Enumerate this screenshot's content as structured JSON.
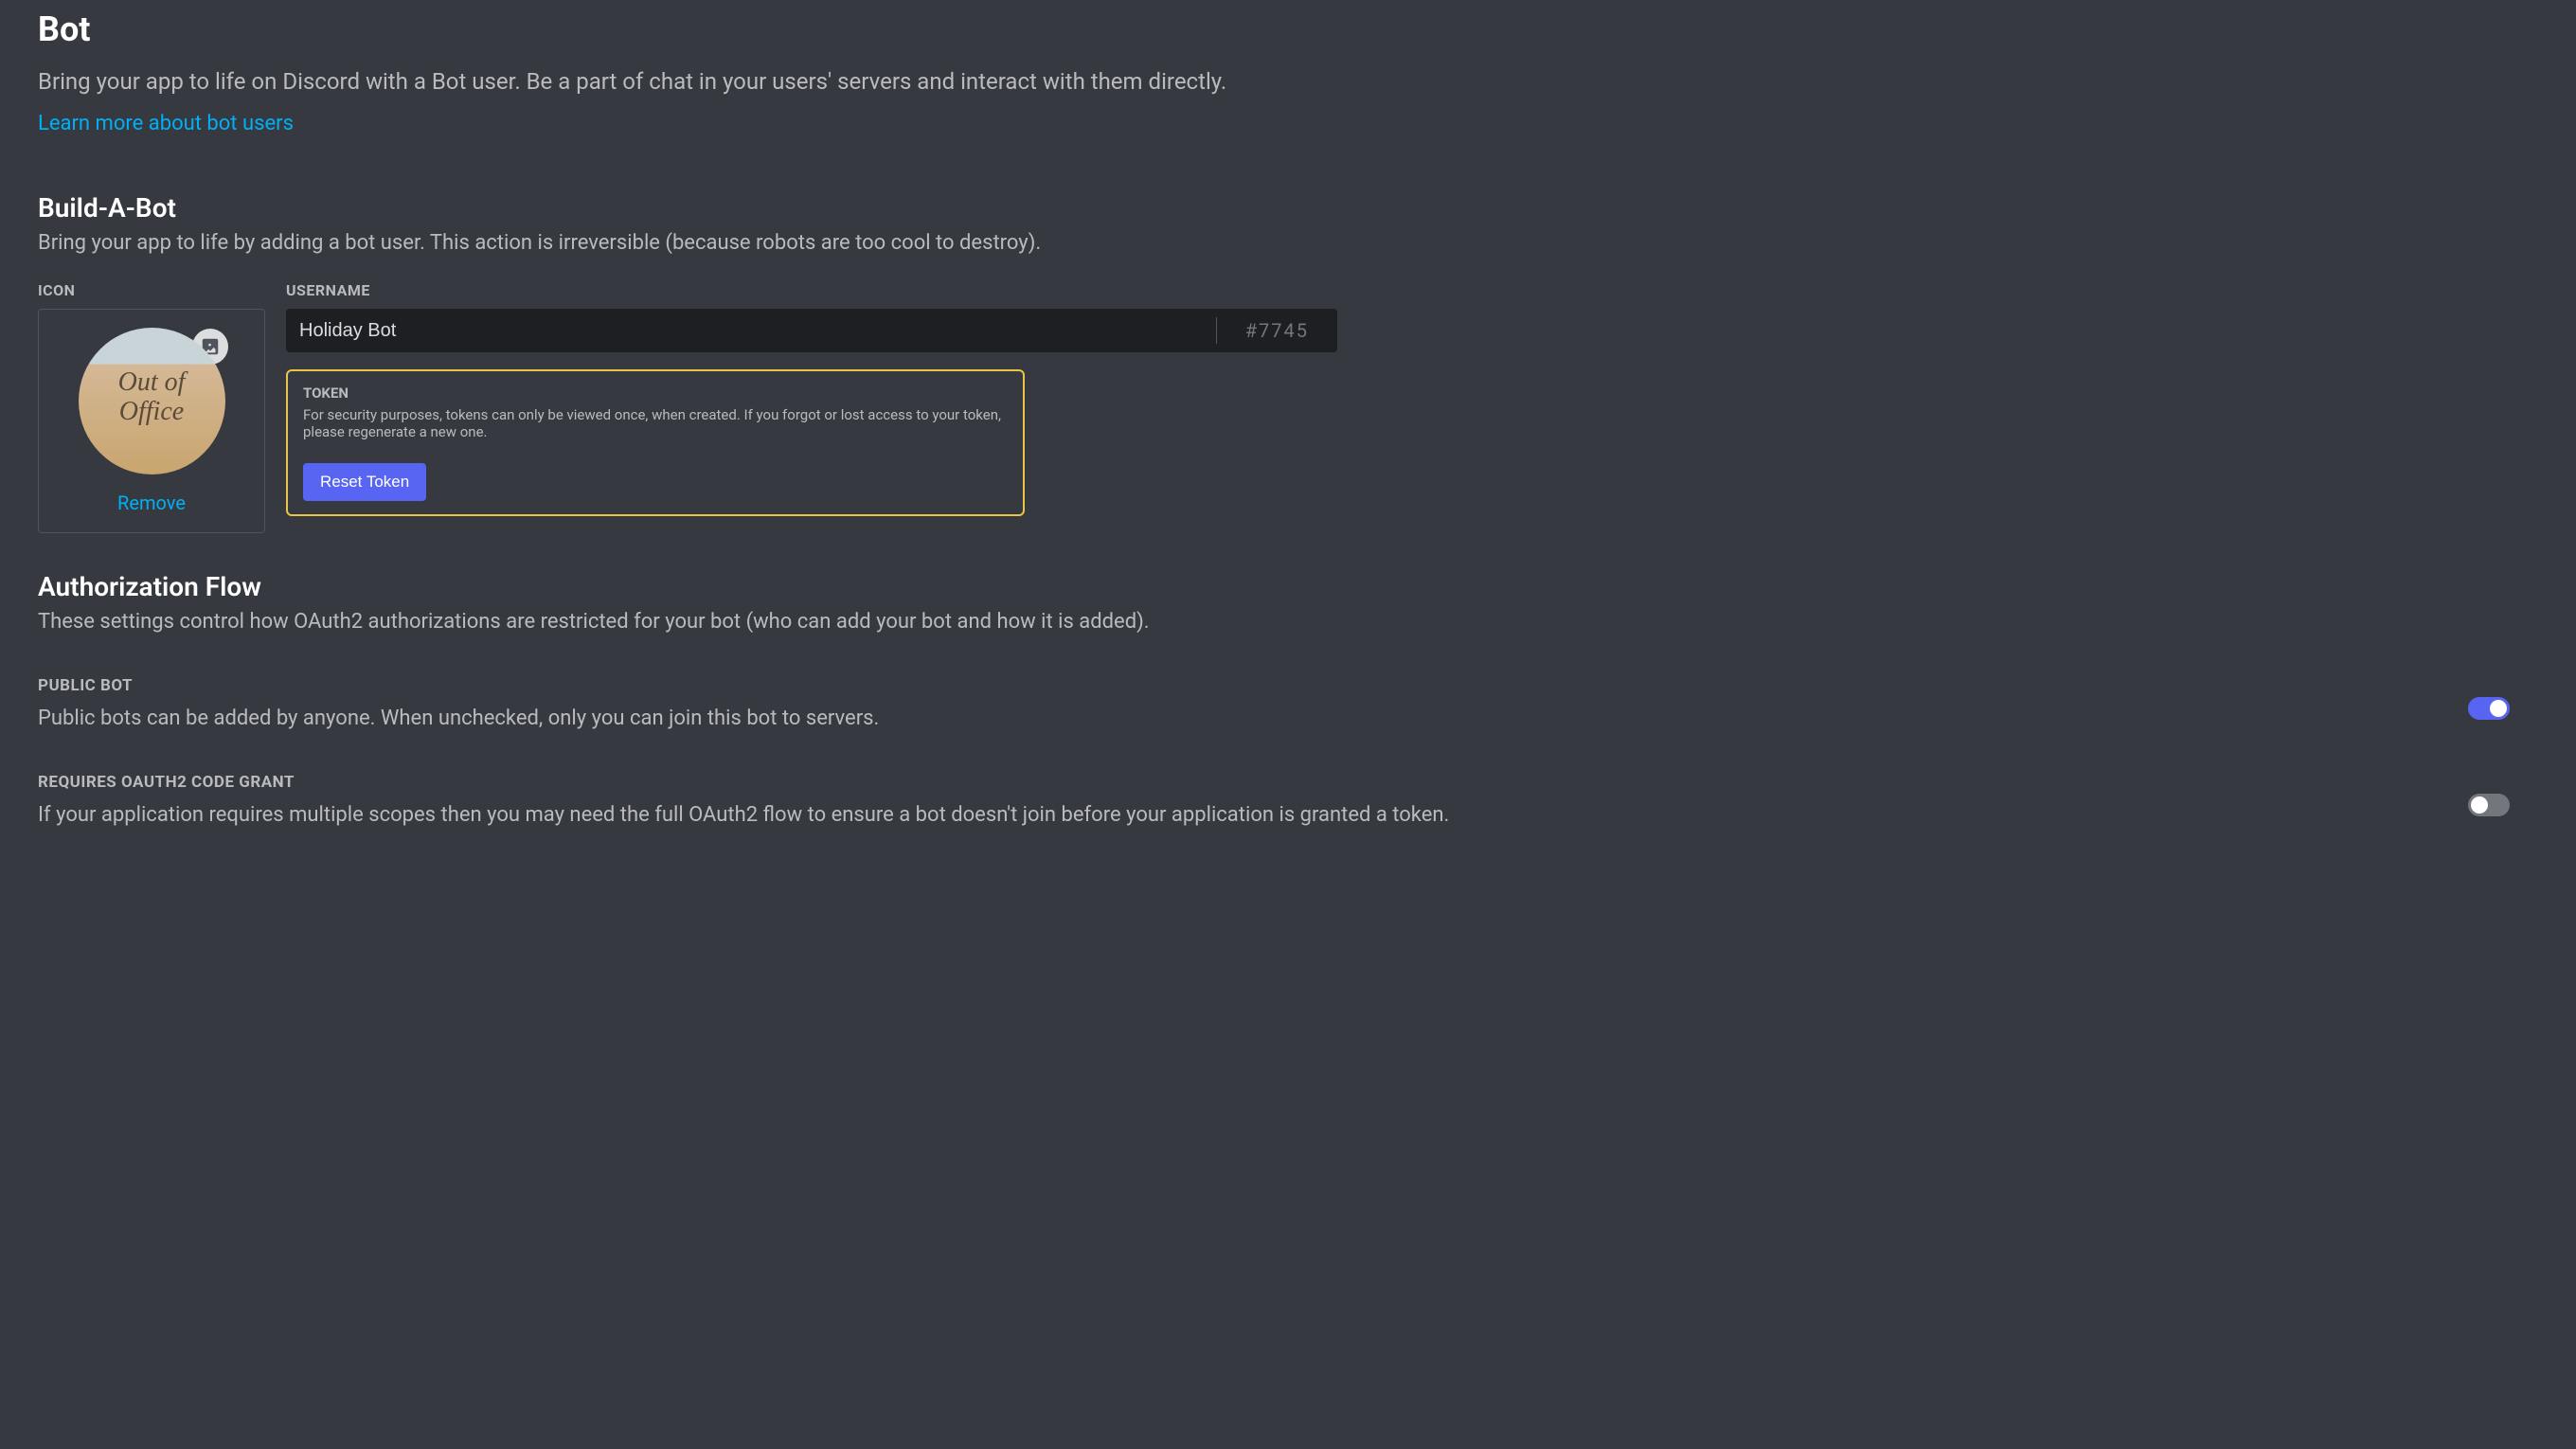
{
  "header": {
    "title": "Bot",
    "subtitle": "Bring your app to life on Discord with a Bot user. Be a part of chat in your users' servers and interact with them directly.",
    "learn_more": "Learn more about bot users"
  },
  "build_bot": {
    "title": "Build-A-Bot",
    "description": "Bring your app to life by adding a bot user. This action is irreversible (because robots are too cool to destroy).",
    "icon_label": "ICON",
    "avatar_text": "Out of Office",
    "remove_label": "Remove",
    "username_label": "USERNAME",
    "username_value": "Holiday Bot",
    "discriminator": "#7745"
  },
  "token": {
    "label": "TOKEN",
    "description": "For security purposes, tokens can only be viewed once, when created. If you forgot or lost access to your token, please regenerate a new one.",
    "reset_button": "Reset Token"
  },
  "auth_flow": {
    "title": "Authorization Flow",
    "description": "These settings control how OAuth2 authorizations are restricted for your bot (who can add your bot and how it is added)."
  },
  "toggles": {
    "public_bot": {
      "heading": "PUBLIC BOT",
      "description": "Public bots can be added by anyone. When unchecked, only you can join this bot to servers.",
      "enabled": true
    },
    "oauth_grant": {
      "heading": "REQUIRES OAUTH2 CODE GRANT",
      "description": "If your application requires multiple scopes then you may need the full OAuth2 flow to ensure a bot doesn't join before your application is granted a token.",
      "enabled": false
    }
  }
}
